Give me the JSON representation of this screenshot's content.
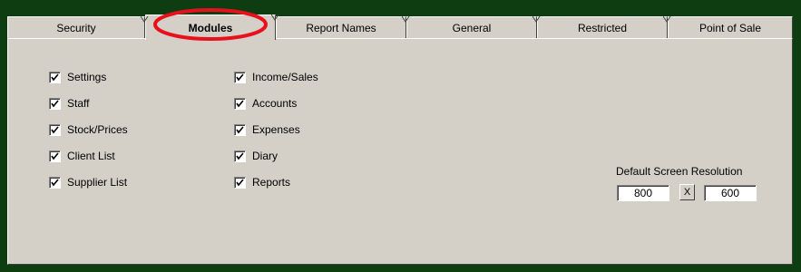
{
  "tabs": [
    {
      "label": "Security",
      "active": false
    },
    {
      "label": "Modules",
      "active": true
    },
    {
      "label": "Report Names",
      "active": false
    },
    {
      "label": "General",
      "active": false
    },
    {
      "label": "Restricted",
      "active": false
    },
    {
      "label": "Point of Sale",
      "active": false
    }
  ],
  "modules_left": [
    {
      "label": "Settings",
      "checked": true
    },
    {
      "label": "Staff",
      "checked": true
    },
    {
      "label": "Stock/Prices",
      "checked": true
    },
    {
      "label": "Client List",
      "checked": true
    },
    {
      "label": "Supplier List",
      "checked": true
    }
  ],
  "modules_right": [
    {
      "label": "Income/Sales",
      "checked": true
    },
    {
      "label": "Accounts",
      "checked": true
    },
    {
      "label": "Expenses",
      "checked": true
    },
    {
      "label": "Diary",
      "checked": true
    },
    {
      "label": "Reports",
      "checked": true
    }
  ],
  "resolution": {
    "label": "Default Screen Resolution",
    "width": "800",
    "separator": "X",
    "height": "600"
  },
  "colors": {
    "background": "#0f3d12",
    "panel": "#d4d0c8",
    "highlight": "#e8101c"
  }
}
